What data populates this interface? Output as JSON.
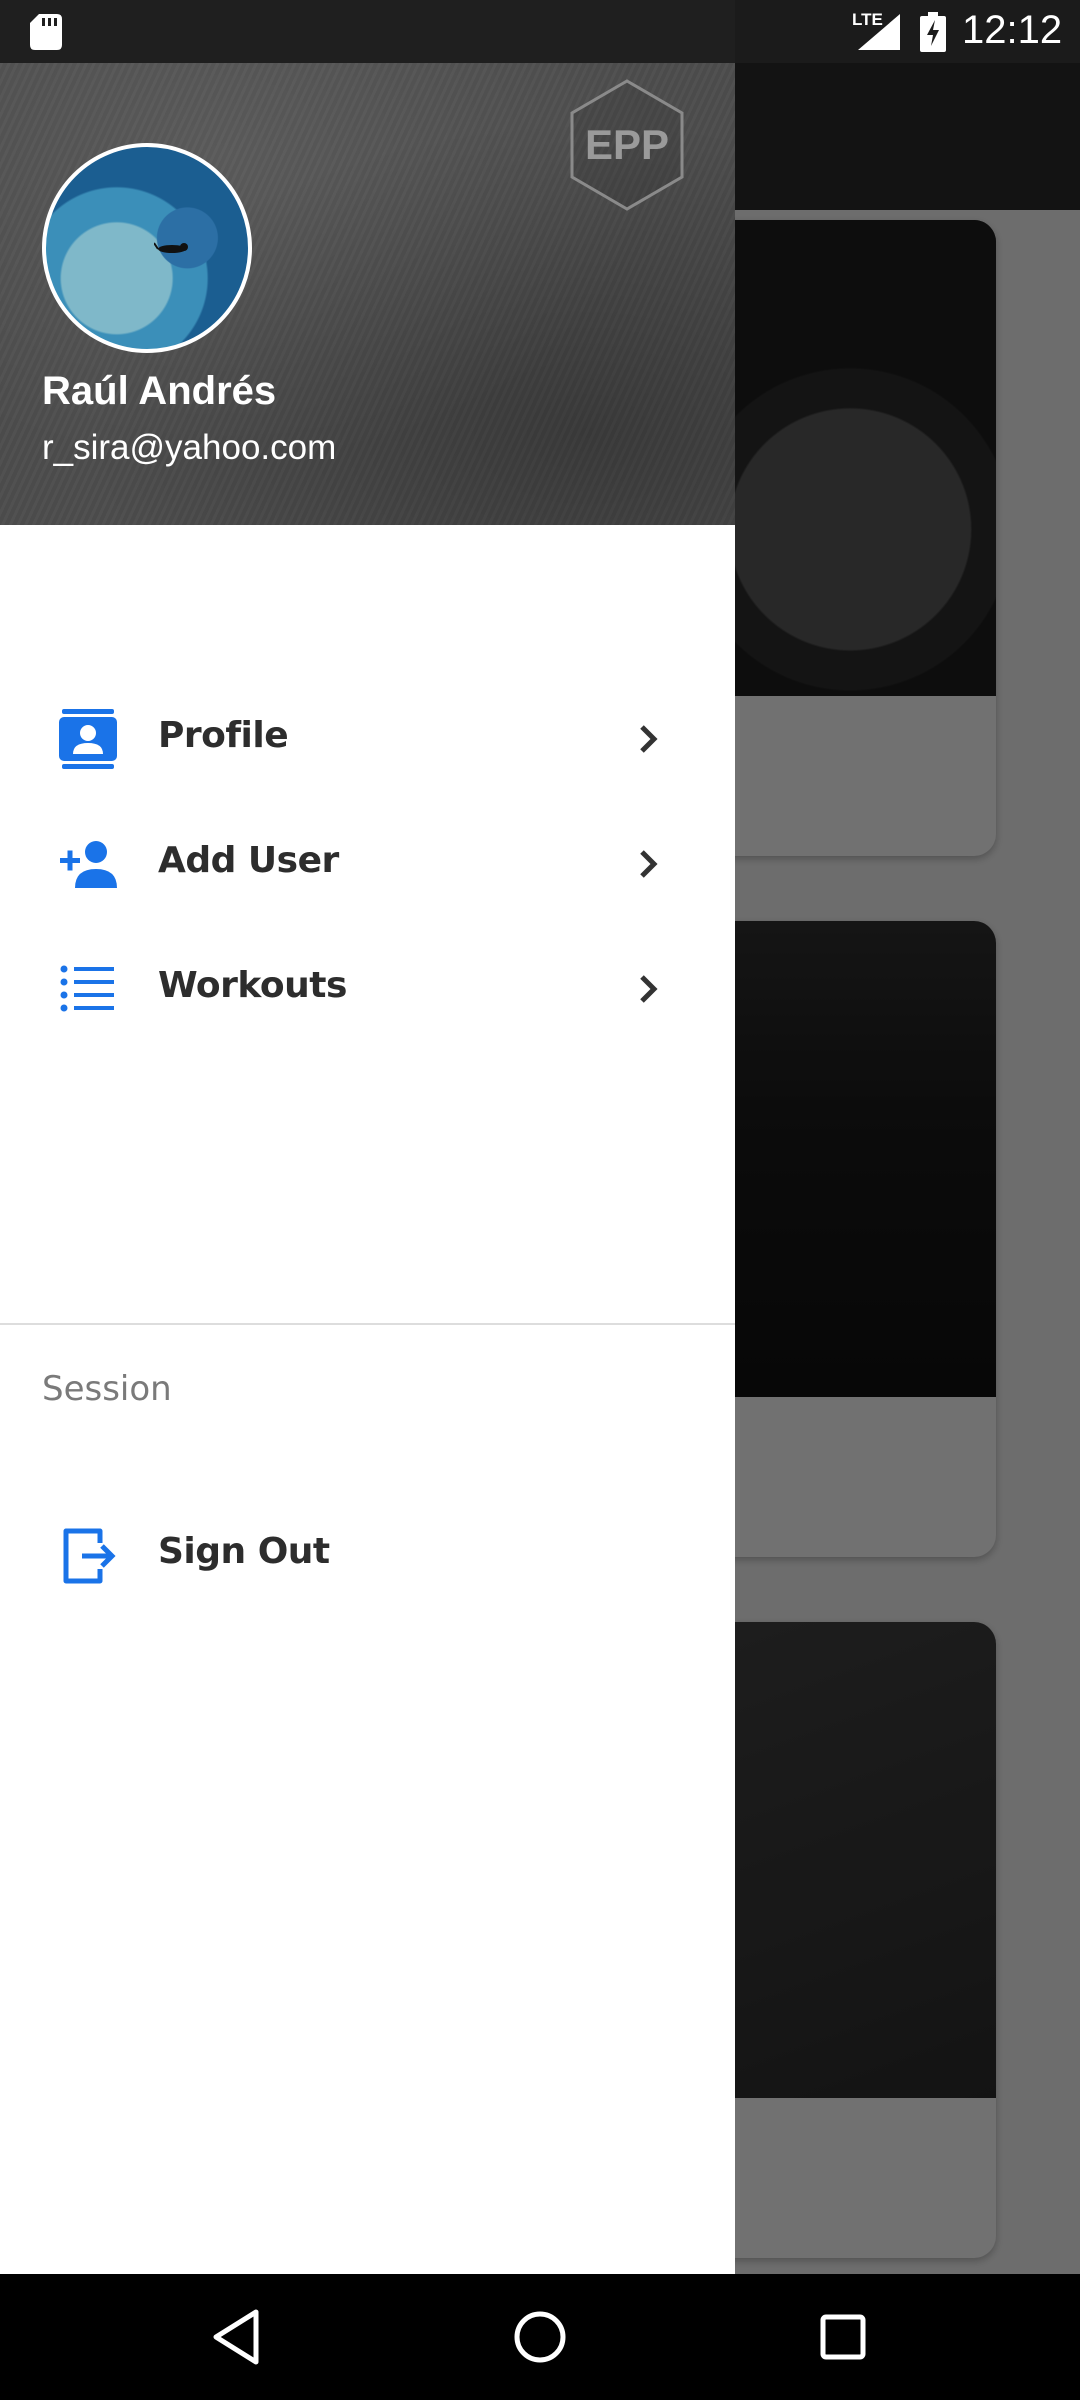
{
  "status_bar": {
    "time": "12:12",
    "network": "LTE",
    "icons": [
      "sd-card-icon",
      "signal-icon",
      "battery-charging-icon"
    ]
  },
  "drawer": {
    "header": {
      "user_name": "Raúl Andrés",
      "user_email": "r_sira@yahoo.com",
      "logo_text": "EPP"
    },
    "items": [
      {
        "label": "Profile",
        "icon": "contact-card-icon"
      },
      {
        "label": "Add User",
        "icon": "person-add-icon"
      },
      {
        "label": "Workouts",
        "icon": "list-icon"
      }
    ],
    "session": {
      "header": "Session",
      "sign_out_label": "Sign Out",
      "sign_out_icon": "exit-icon"
    }
  },
  "colors": {
    "accent": "#1a73e8",
    "header_bg": "#4d4d4d",
    "text": "#2d2d2d",
    "section_text": "#7a7a7a"
  },
  "nav_bar": {
    "buttons": [
      "back-icon",
      "home-icon",
      "recents-icon"
    ]
  }
}
